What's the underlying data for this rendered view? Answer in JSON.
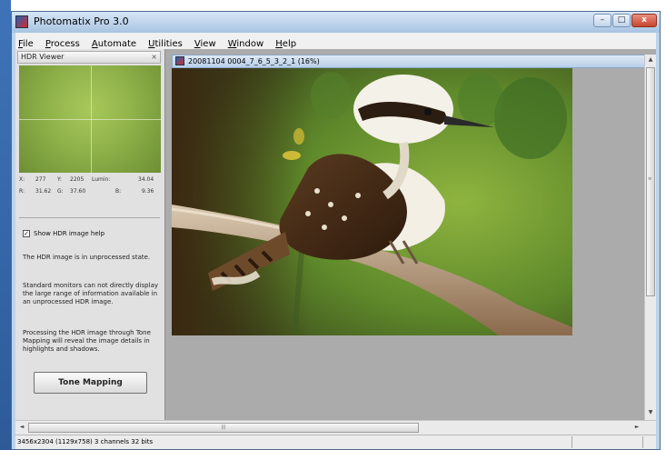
{
  "window": {
    "title": "Photomatix Pro 3.0",
    "controls": {
      "minimize": "–",
      "maximize": "□",
      "close": "x"
    }
  },
  "menu": [
    {
      "label": "File",
      "u": "F",
      "rest": "ile"
    },
    {
      "label": "Process",
      "u": "P",
      "rest": "rocess"
    },
    {
      "label": "Automate",
      "u": "A",
      "rest": "utomate"
    },
    {
      "label": "Utilities",
      "u": "U",
      "rest": "tilities"
    },
    {
      "label": "View",
      "u": "V",
      "rest": "iew"
    },
    {
      "label": "Window",
      "u": "W",
      "rest": "indow"
    },
    {
      "label": "Help",
      "u": "H",
      "rest": "elp"
    }
  ],
  "hdr_viewer": {
    "title": "HDR Viewer",
    "close_glyph": "×",
    "x_label": "X:",
    "x_value": "277",
    "y_label": "Y:",
    "y_value": "2205",
    "lumin_label": "Lumin:",
    "lumin_value": "34.04",
    "r_label": "R:",
    "r_value": "31.62",
    "g_label": "G:",
    "g_value": "37.60",
    "b_label": "B:",
    "b_value": "9.36",
    "show_help_label": "Show HDR image help",
    "show_help_checked": true,
    "help_paragraphs": [
      "The HDR image is in unprocessed state.",
      "Standard monitors can not directly display the large range of information available in an unprocessed HDR image.",
      "Processing the HDR image through Tone Mapping will reveal the image details in highlights and shadows."
    ],
    "tone_mapping_button": "Tone Mapping"
  },
  "document": {
    "title": "20081104 0004_7_6_5_3_2_1 (16%)"
  },
  "status": {
    "text": "3456x2304 (1129x758) 3 channels 32 bits"
  },
  "icons": {
    "app": "photomatix-icon",
    "checkbox_mark": "✓",
    "scroll_up": "▲",
    "scroll_down": "▼",
    "scroll_left": "◄",
    "scroll_right": "►",
    "grip": "≡",
    "grip_h": "|||"
  }
}
